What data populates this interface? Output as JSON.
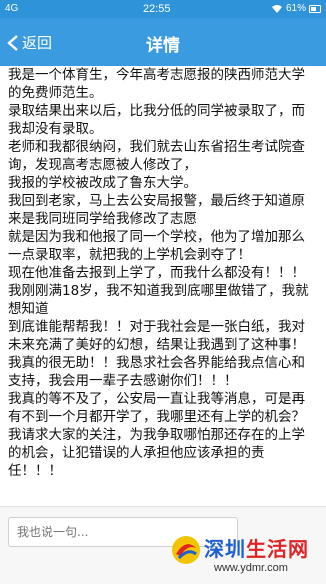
{
  "status_bar": {
    "network": "4G",
    "time": "22:55",
    "battery": "61%"
  },
  "nav": {
    "back_label": "返回",
    "title": "详情"
  },
  "post": {
    "paragraphs": [
      "我是一个体育生，今年高考志愿报的陕西师范大学的免费师范生。",
      "录取结果出来以后，比我分低的同学被录取了，而我却没有录取。",
      "老师和我都很纳闷，我们就去山东省招生考试院查询，发现高考志愿被人修改了，",
      "我报的学校被改成了鲁东大学。",
      "我回到老家，马上去公安局报警，最后终于知道原来是我同班同学给我修改了志愿",
      "就是因为我和他报了同一个学校，他为了增加那么一点录取率，就把我的上学机会剥夺了！",
      "现在他准备去报到上学了，而我什么都没有！！！",
      "我刚刚满18岁，我不知道我到底哪里做错了，我就想知道",
      "到底谁能帮帮我！！对于我社会是一张白纸，我对未来充满了美好的幻想，结果让我遇到了这种事！我真的很无助！！我恳求社会各界能给我点信心和支持，我会用一辈子去感谢你们！！！",
      "我真的等不及了，公安局一直让我等消息，可是再有不到一个月都开学了，我哪里还有上学的机会？我请求大家的关注，为我争取哪怕那还存在的上学的机会，让犯错误的人承担他应该承担的责任！！！"
    ]
  },
  "comment": {
    "placeholder": "我也说一句..."
  },
  "watermark": {
    "title_part1": "深圳",
    "title_part2": "生活网",
    "url": "www.ydmr.com"
  },
  "icons": {
    "back": "chevron-left-icon",
    "wifi": "wifi-icon",
    "battery": "battery-icon"
  }
}
